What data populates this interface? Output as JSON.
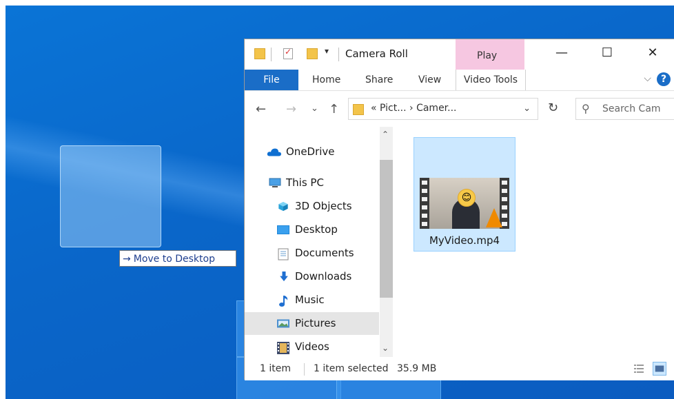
{
  "drag": {
    "tooltip": "Move to Desktop",
    "arrow": "→"
  },
  "window": {
    "title": "Camera Roll",
    "context_group": "Play",
    "controls": {
      "minimize": "—",
      "maximize": "☐",
      "close": "✕"
    },
    "quick_access_dropdown": "▾"
  },
  "ribbon": {
    "tabs": [
      "File",
      "Home",
      "Share",
      "View",
      "Video Tools"
    ],
    "collapse": "⌵",
    "help": "?"
  },
  "address": {
    "back": "←",
    "forward": "→",
    "recent": "⌄",
    "up": "↑",
    "path": "« Pict... › Camer...",
    "dropdown": "⌄",
    "refresh": "↻",
    "search_icon": "⚲",
    "search_placeholder": "Search Cam"
  },
  "nav": {
    "items": [
      {
        "label": "OneDrive",
        "icon": "cloud-icon"
      },
      {
        "label": "This PC",
        "icon": "pc-icon"
      },
      {
        "label": "3D Objects",
        "icon": "cube-icon"
      },
      {
        "label": "Desktop",
        "icon": "desktop-icon"
      },
      {
        "label": "Documents",
        "icon": "document-icon"
      },
      {
        "label": "Downloads",
        "icon": "download-icon"
      },
      {
        "label": "Music",
        "icon": "music-icon"
      },
      {
        "label": "Pictures",
        "icon": "picture-icon"
      },
      {
        "label": "Videos",
        "icon": "video-icon"
      }
    ],
    "scroll_up": "⌃",
    "scroll_down": "⌄"
  },
  "file": {
    "name": "MyVideo.mp4",
    "face": "😊"
  },
  "status": {
    "count": "1 item",
    "selected": "1 item selected",
    "size": "35.9 MB"
  },
  "colors": {
    "accent": "#1a6dc7",
    "selection": "#cce8ff",
    "context_tab": "#f6c7e1"
  }
}
